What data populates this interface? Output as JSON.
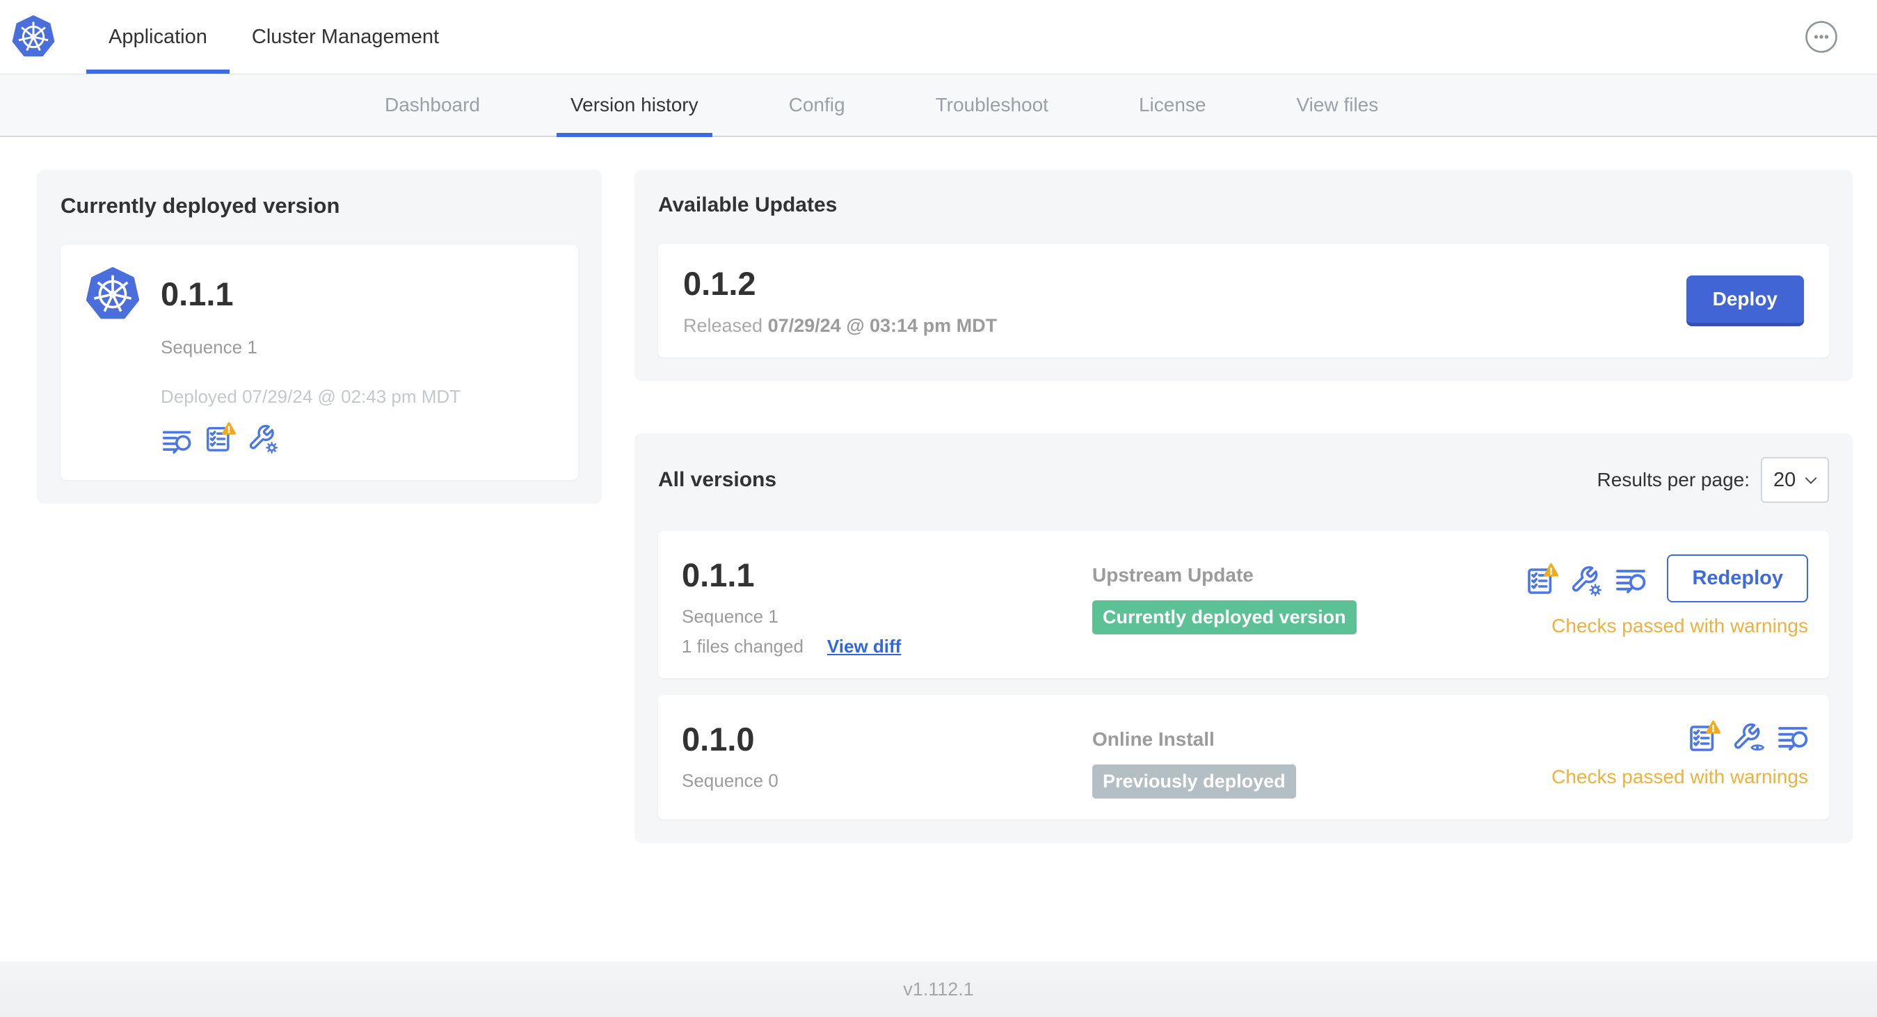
{
  "colors": {
    "accent_blue": "#3b6ce4",
    "icon_blue": "#4a77e5",
    "deploy_button_blue": "#4265d6",
    "green_badge": "#5cc194",
    "gray_badge": "#b4bec5",
    "warning_text_orange": "#edb13f",
    "warning_triangle": "#f1ab19"
  },
  "icons": {
    "brand": "kubernetes-logo",
    "header_menu": "ellipsis-icon",
    "logs": "diff-lines-search-icon",
    "preflight": "checklist-warning-icon",
    "edit_config": "wrench-gear-icon",
    "view_config": "wrench-eye-icon",
    "select_chevron": "chevron-down-icon"
  },
  "header": {
    "tabs": [
      {
        "label": "Application"
      },
      {
        "label": "Cluster Management"
      }
    ]
  },
  "subnav": {
    "tabs": [
      {
        "label": "Dashboard"
      },
      {
        "label": "Version history"
      },
      {
        "label": "Config"
      },
      {
        "label": "Troubleshoot"
      },
      {
        "label": "License"
      },
      {
        "label": "View files"
      }
    ]
  },
  "currently_deployed": {
    "title": "Currently deployed version",
    "version": "0.1.1",
    "sequence": "Sequence 1",
    "deployed": "Deployed 07/29/24 @ 02:43 pm MDT"
  },
  "available_updates": {
    "title": "Available Updates",
    "version": "0.1.2",
    "released_prefix": "Released",
    "released_date": "07/29/24 @ 03:14 pm MDT",
    "deploy_label": "Deploy"
  },
  "all_versions": {
    "title": "All versions",
    "results_per_page_label": "Results per page:",
    "results_per_page_value": "20",
    "rows": [
      {
        "version": "0.1.1",
        "sequence": "Sequence 1",
        "files_changed": "1 files changed",
        "view_diff_label": "View diff",
        "source": "Upstream Update",
        "badge": "Currently deployed version",
        "checks": "Checks passed with warnings",
        "action_label": "Redeploy"
      },
      {
        "version": "0.1.0",
        "sequence": "Sequence 0",
        "source": "Online Install",
        "badge": "Previously deployed",
        "checks": "Checks passed with warnings"
      }
    ]
  },
  "footer": {
    "app_version": "v1.112.1"
  }
}
